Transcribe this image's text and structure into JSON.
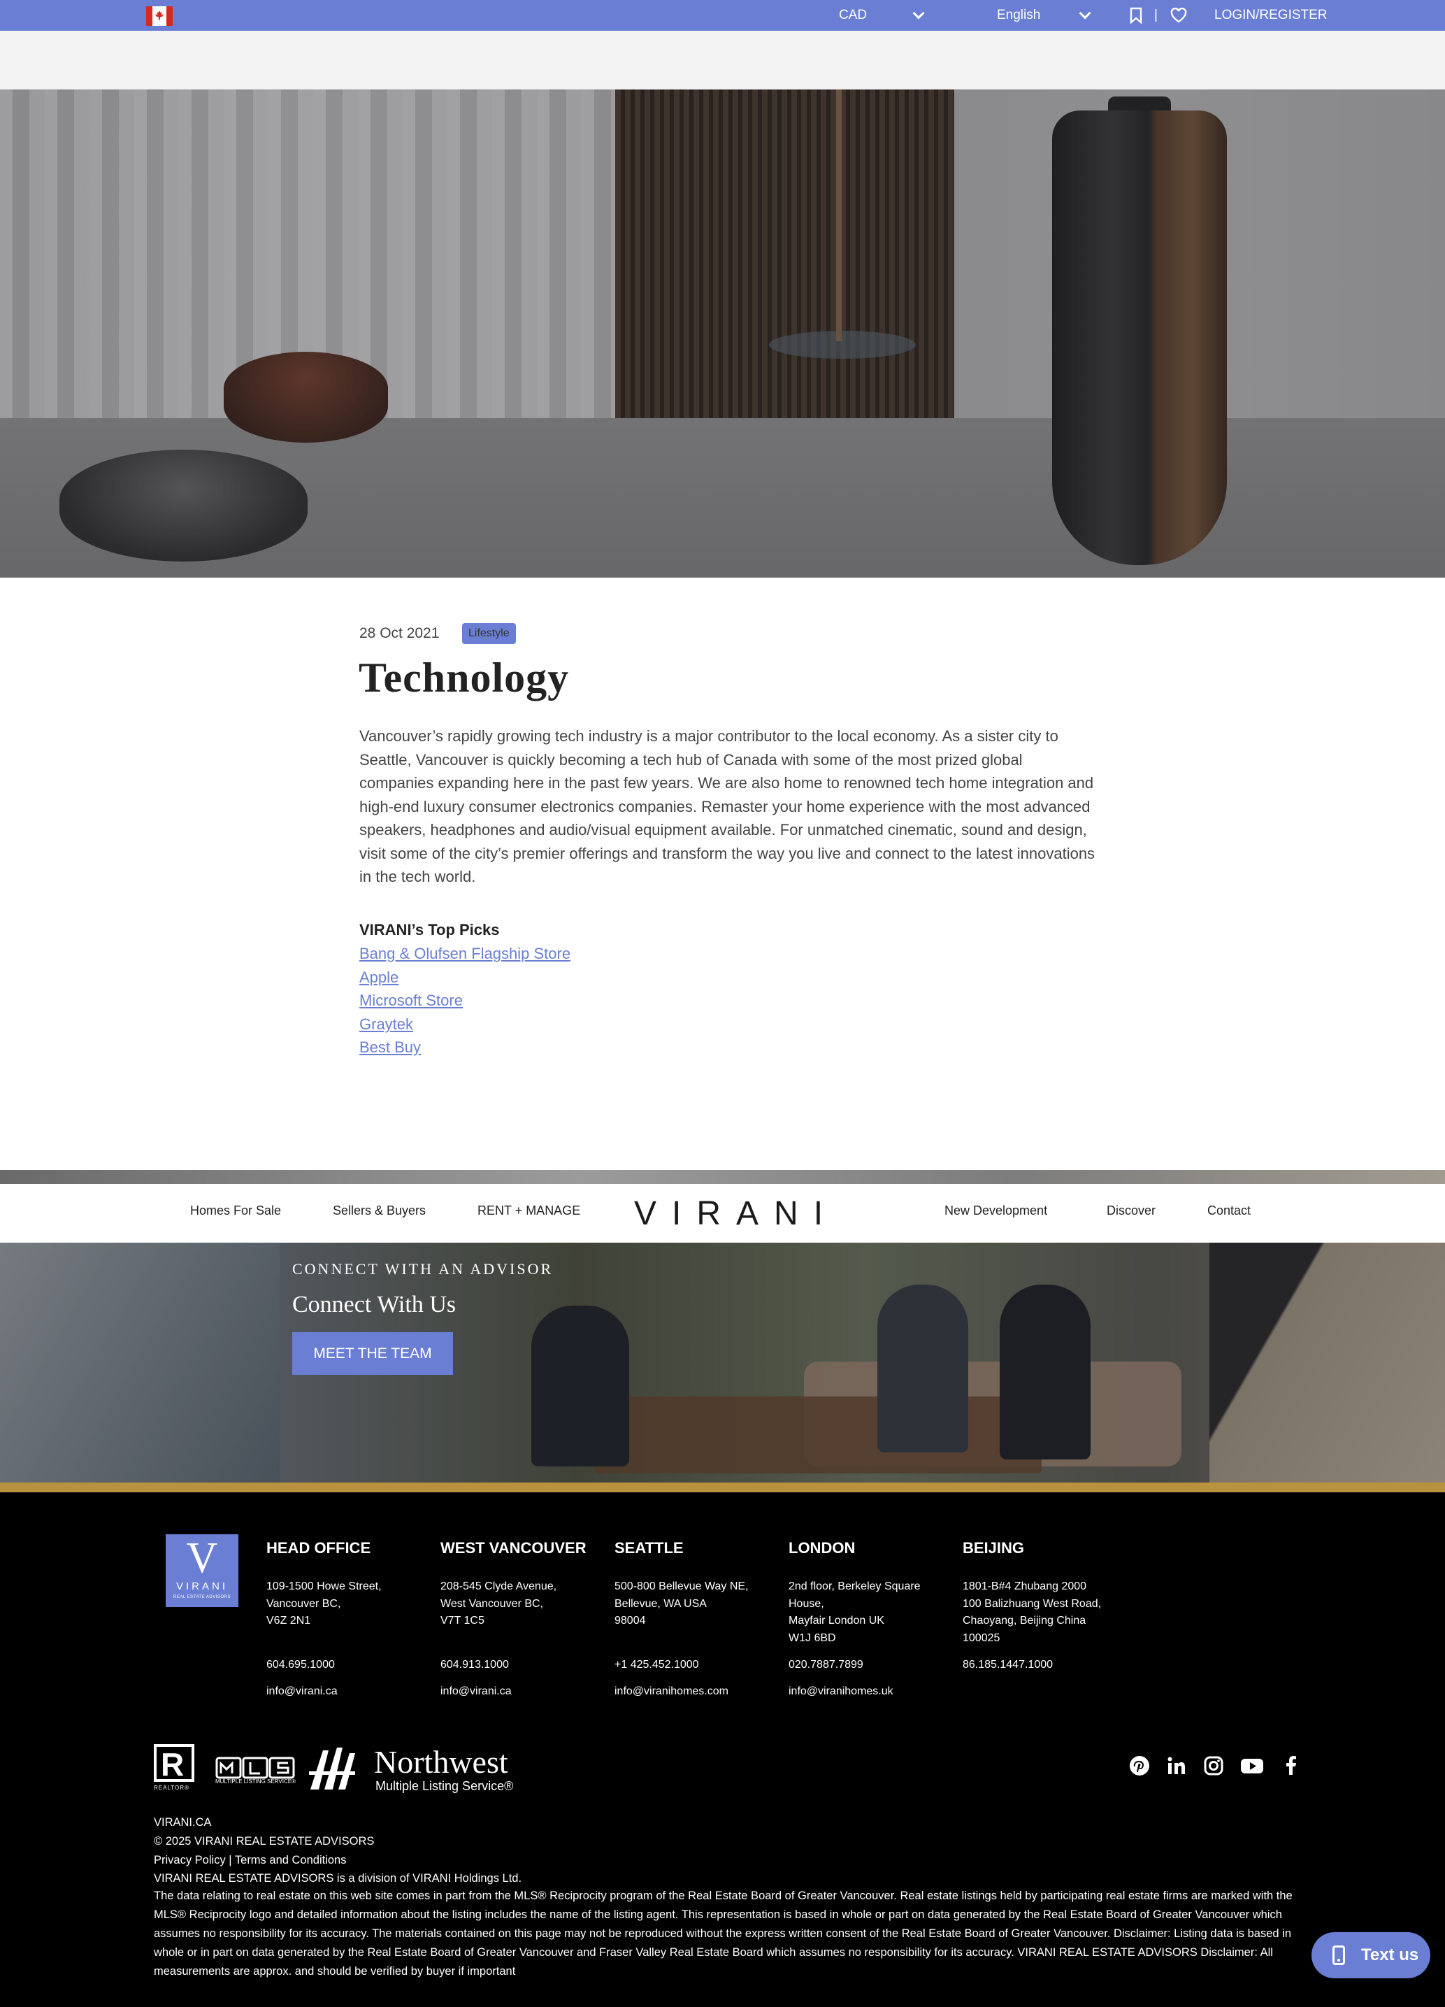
{
  "topbar": {
    "currency": "CAD",
    "language": "English",
    "divider": "|",
    "login": "LOGIN/REGISTER",
    "accent": "#6a7fd4"
  },
  "article": {
    "date": "28 Oct 2021",
    "tag": "Lifestyle",
    "title": "Technology",
    "body": "Vancouver’s rapidly growing tech industry is a major contributor to the local economy. As a sister city to Seattle, Vancouver is quickly becoming a tech hub of Canada with some of the most prized global companies expanding here in the past few years. We are also home to renowned tech home integration and high-end luxury consumer electronics companies. Remaster your home experience with the most advanced speakers, headphones and audio/visual equipment available. For unmatched cinematic, sound and design, visit some of the city’s premier offerings and transform the way you live and connect to the latest innovations in the tech world.",
    "picks_heading": "VIRANI’s Top Picks",
    "picks": [
      "Bang & Olufsen Flagship Store",
      "Apple",
      "Microsoft Store",
      "Graytek",
      "Best Buy"
    ]
  },
  "nav": {
    "left": [
      "Homes For Sale",
      "Sellers & Buyers",
      "RENT + MANAGE"
    ],
    "logo": "VIRANI",
    "right": [
      "New Development",
      "Discover",
      "Contact"
    ]
  },
  "banner": {
    "kicker": "CONNECT WITH AN ADVISOR",
    "title": "Connect With Us",
    "button": "MEET THE TEAM"
  },
  "footer": {
    "logo_letter": "V",
    "logo_word": "VIRANI",
    "logo_sub": "REAL ESTATE ADVISORS",
    "offices": [
      {
        "name": "HEAD OFFICE",
        "address": [
          "109-1500 Howe Street,",
          "Vancouver BC,",
          "V6Z 2N1"
        ],
        "phone": "604.695.1000",
        "email": "info@virani.ca"
      },
      {
        "name": "WEST VANCOUVER",
        "address": [
          "208-545 Clyde Avenue,",
          "West Vancouver BC,",
          "V7T 1C5"
        ],
        "phone": "604.913.1000",
        "email": "info@virani.ca"
      },
      {
        "name": "SEATTLE",
        "address": [
          "500-800 Bellevue Way NE,",
          "Bellevue, WA USA",
          "98004"
        ],
        "phone": "+1 425.452.1000",
        "email": "info@viranihomes.com"
      },
      {
        "name": "LONDON",
        "address": [
          "2nd floor, Berkeley Square",
          "House,",
          "Mayfair London UK",
          "W1J 6BD"
        ],
        "phone": "020.7887.7899",
        "email": "info@viranihomes.uk"
      },
      {
        "name": "BEIJING",
        "address": [
          "1801-B#4 Zhubang 2000",
          "100 Balizhuang West Road,",
          "Chaoyang, Beijing China",
          "100025"
        ],
        "phone": "86.185.1447.1000",
        "email": ""
      }
    ],
    "realtor_label": "REALTOR®",
    "mls_label": "MULTIPLE LISTING SERVICE®",
    "nw_title": "Northwest",
    "nw_sub": "Multiple Listing Service®",
    "social": [
      "pinterest-icon",
      "linkedin-icon",
      "instagram-icon",
      "youtube-icon",
      "facebook-icon"
    ],
    "site": "VIRANI.CA",
    "copyright": "© 2025 VIRANI REAL ESTATE ADVISORS",
    "privacy": "Privacy Policy",
    "sep": "|",
    "terms": "Terms and Conditions",
    "division": "VIRANI REAL ESTATE ADVISORS is a division of VIRANI Holdings Ltd.",
    "disclaimer": "The data relating to real estate on this web site comes in part from the MLS® Reciprocity program of the Real Estate Board of Greater Vancouver. Real estate listings held by participating real estate firms are marked with the MLS® Reciprocity logo and detailed information about the listing includes the name of the listing agent. This representation is based in whole or part on data generated by the Real Estate Board of Greater Vancouver which assumes no responsibility for its accuracy. The materials contained on this page may not be reproduced without the express written consent of the Real Estate Board of Greater Vancouver. Disclaimer: Listing data is based in whole or in part on data generated by the Real Estate Board of Greater Vancouver and Fraser Valley Real Estate Board which assumes no responsibility for its accuracy. VIRANI REAL ESTATE ADVISORS Disclaimer: All measurements are approx. and should be verified by buyer if important"
  },
  "chat": {
    "label": "Text us"
  }
}
